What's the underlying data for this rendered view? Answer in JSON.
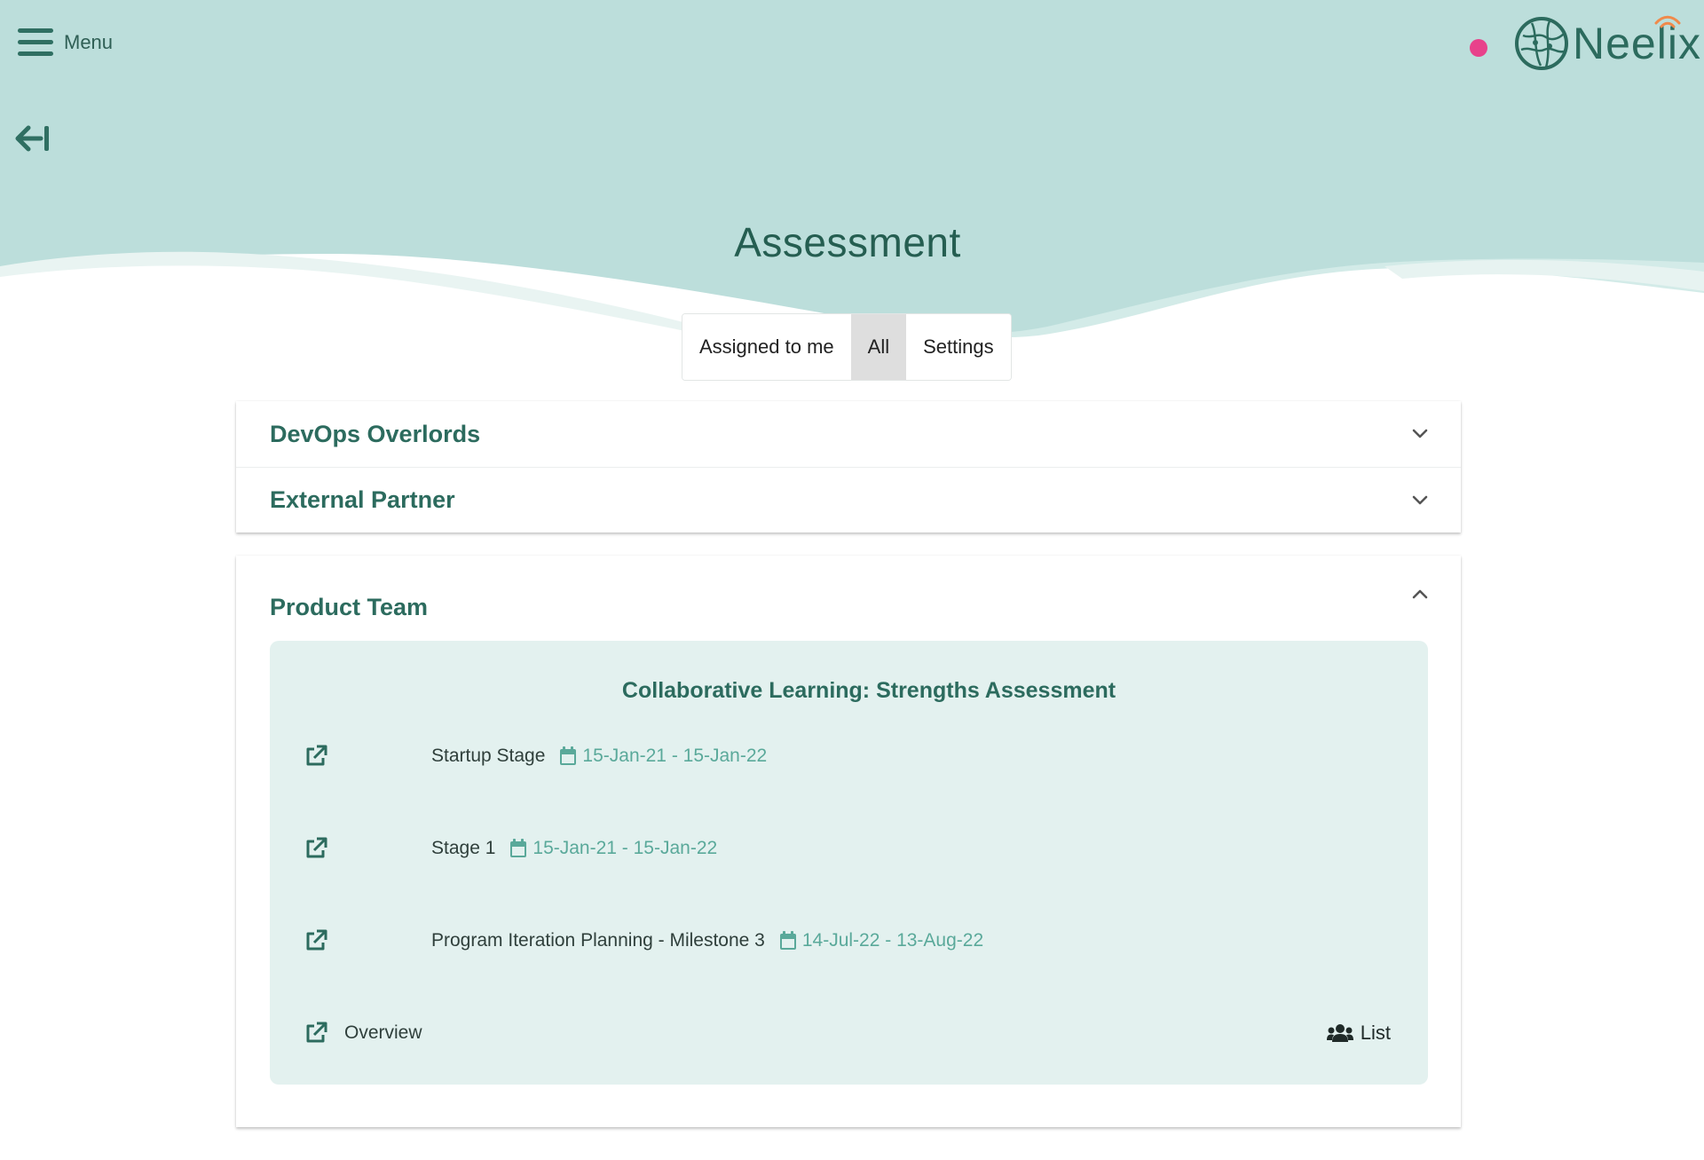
{
  "header": {
    "menu_label": "Menu",
    "brand": "Neelix",
    "page_title": "Assessment"
  },
  "colors": {
    "header_bg": "#bcdedb",
    "accent": "#2c6b5e",
    "date_text": "#5aa99a",
    "status_dot": "#e8428b",
    "panel_bg": "#e3f1ef"
  },
  "tabs": [
    {
      "label": "Assigned to me",
      "active": false
    },
    {
      "label": "All",
      "active": true
    },
    {
      "label": "Settings",
      "active": false
    }
  ],
  "groups": [
    {
      "title": "DevOps Overlords",
      "expanded": false
    },
    {
      "title": "External Partner",
      "expanded": false
    },
    {
      "title": "Product Team",
      "expanded": true
    }
  ],
  "assessment": {
    "title": "Collaborative Learning: Strengths Assessment",
    "stages": [
      {
        "name": "Startup Stage",
        "dates": "15-Jan-21 - 15-Jan-22"
      },
      {
        "name": "Stage 1",
        "dates": "15-Jan-21 - 15-Jan-22"
      },
      {
        "name": "Program Iteration Planning - Milestone 3",
        "dates": "14-Jul-22 - 13-Aug-22"
      }
    ],
    "overview_label": "Overview",
    "list_label": "List"
  },
  "icons": {
    "menu": "hamburger-icon",
    "back": "arrow-left-to-bar-icon",
    "expand": "chevron-down-icon",
    "collapse": "chevron-up-icon",
    "open": "external-link-icon",
    "date": "calendar-icon",
    "list": "users-icon"
  }
}
